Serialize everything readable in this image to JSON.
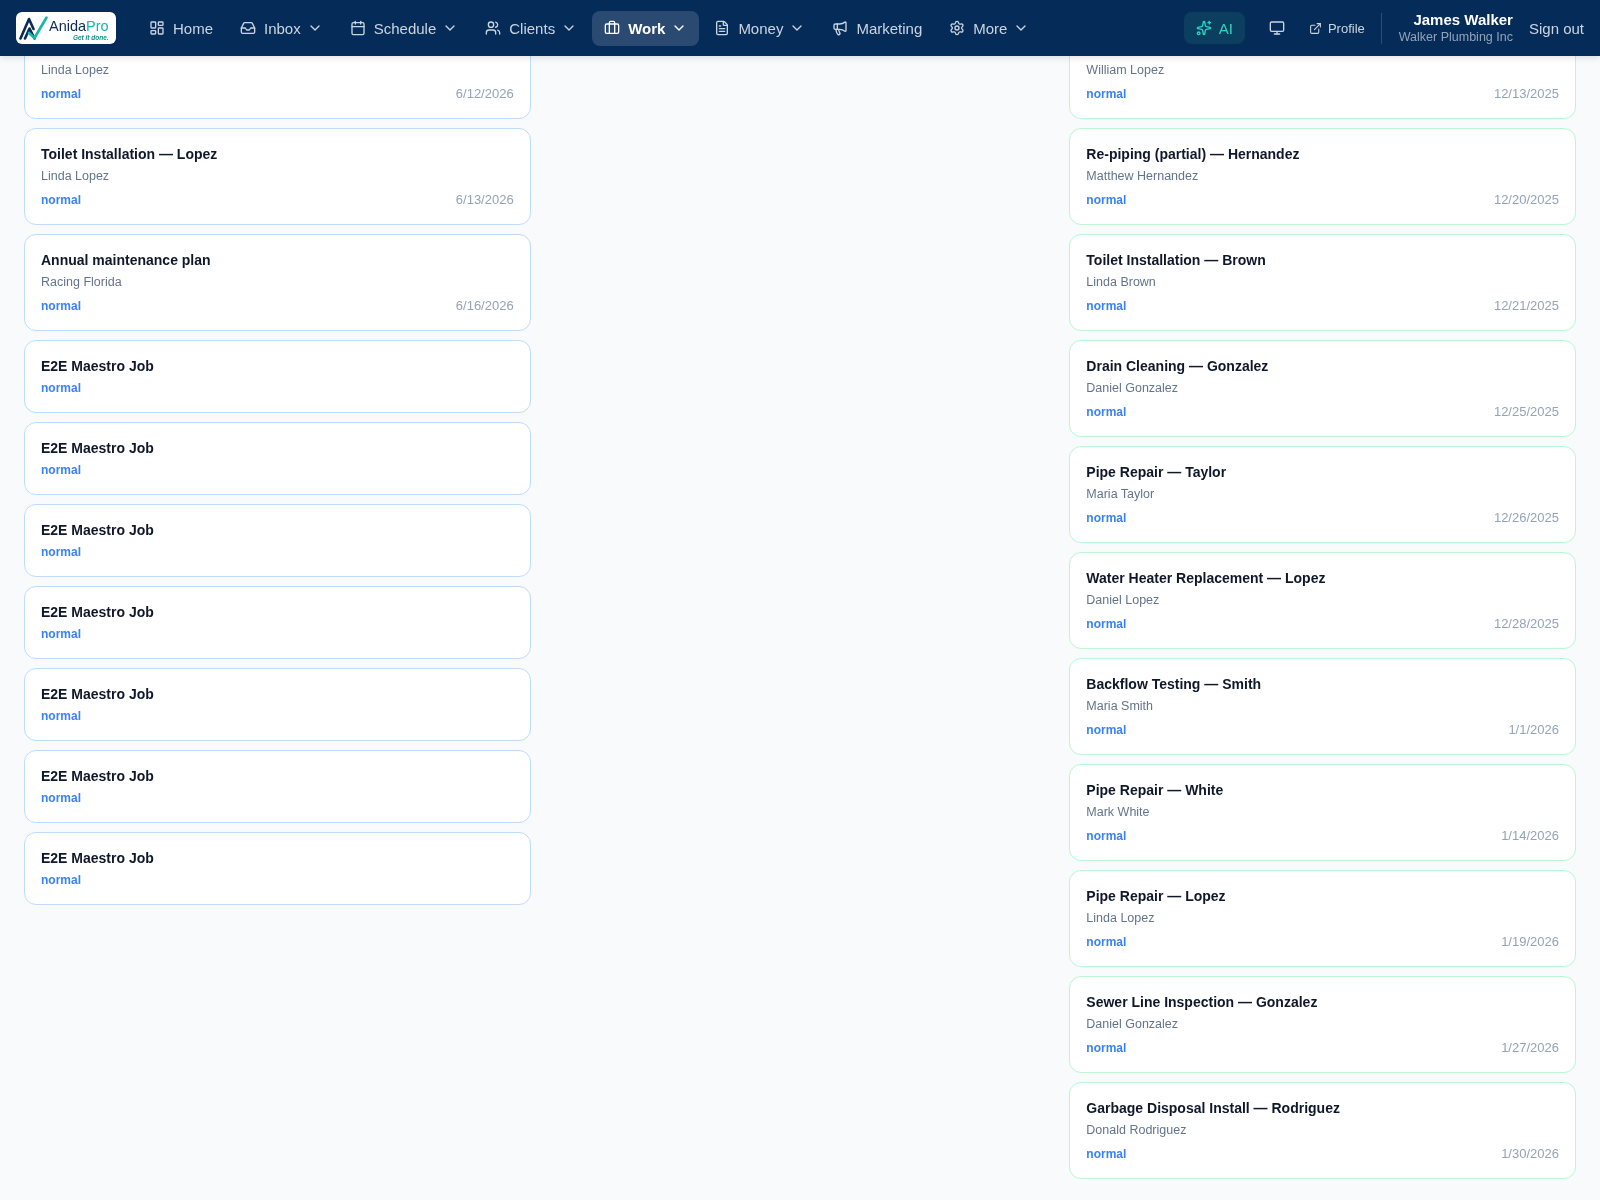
{
  "nav": {
    "logo": {
      "wordmark": "Anida",
      "wordmark_accent": "Pro",
      "tagline": "Get it done."
    },
    "items": [
      {
        "label": "Home",
        "selected": false,
        "dropdown": false
      },
      {
        "label": "Inbox",
        "selected": false,
        "dropdown": true
      },
      {
        "label": "Schedule",
        "selected": false,
        "dropdown": true
      },
      {
        "label": "Clients",
        "selected": false,
        "dropdown": true
      },
      {
        "label": "Work",
        "selected": true,
        "dropdown": true
      },
      {
        "label": "Money",
        "selected": false,
        "dropdown": true
      },
      {
        "label": "Marketing",
        "selected": false,
        "dropdown": false
      },
      {
        "label": "More",
        "selected": false,
        "dropdown": true
      }
    ],
    "ai_button": {
      "label": "AI"
    },
    "profile_link": {
      "label": "Profile"
    },
    "user": {
      "name": "James Walker",
      "company": "Walker Plumbing Inc"
    },
    "sign_out": {
      "label": "Sign out"
    }
  },
  "board": {
    "columns": [
      {
        "color": "#bfdbfe",
        "cards": [
          {
            "client": "Linda Lopez",
            "priority": "normal",
            "date": "6/12/2026"
          },
          {
            "title": "Toilet Installation — Lopez",
            "client": "Linda Lopez",
            "priority": "normal",
            "date": "6/13/2026"
          },
          {
            "title": "Annual maintenance plan",
            "client": "Racing Florida",
            "priority": "normal",
            "date": "6/16/2026"
          },
          {
            "title": "E2E Maestro Job",
            "priority": "normal"
          },
          {
            "title": "E2E Maestro Job",
            "priority": "normal"
          },
          {
            "title": "E2E Maestro Job",
            "priority": "normal"
          },
          {
            "title": "E2E Maestro Job",
            "priority": "normal"
          },
          {
            "title": "E2E Maestro Job",
            "priority": "normal"
          },
          {
            "title": "E2E Maestro Job",
            "priority": "normal"
          },
          {
            "title": "E2E Maestro Job",
            "priority": "normal"
          }
        ]
      },
      {},
      {
        "color": "#bbf7d0",
        "cards": [
          {
            "client": "William Lopez",
            "priority": "normal",
            "date": "12/13/2025"
          },
          {
            "title": "Re-piping (partial) — Hernandez",
            "client": "Matthew Hernandez",
            "priority": "normal",
            "date": "12/20/2025"
          },
          {
            "title": "Toilet Installation — Brown",
            "client": "Linda Brown",
            "priority": "normal",
            "date": "12/21/2025"
          },
          {
            "title": "Drain Cleaning — Gonzalez",
            "client": "Daniel Gonzalez",
            "priority": "normal",
            "date": "12/25/2025"
          },
          {
            "title": "Pipe Repair — Taylor",
            "client": "Maria Taylor",
            "priority": "normal",
            "date": "12/26/2025"
          },
          {
            "title": "Water Heater Replacement — Lopez",
            "client": "Daniel Lopez",
            "priority": "normal",
            "date": "12/28/2025"
          },
          {
            "title": "Backflow Testing — Smith",
            "client": "Maria Smith",
            "priority": "normal",
            "date": "1/1/2026"
          },
          {
            "title": "Pipe Repair — White",
            "client": "Mark White",
            "priority": "normal",
            "date": "1/14/2026"
          },
          {
            "title": "Pipe Repair — Lopez",
            "client": "Linda Lopez",
            "priority": "normal",
            "date": "1/19/2026"
          },
          {
            "title": "Sewer Line Inspection — Gonzalez",
            "client": "Daniel Gonzalez",
            "priority": "normal",
            "date": "1/27/2026"
          },
          {
            "title": "Garbage Disposal Install — Rodriguez",
            "client": "Donald Rodriguez",
            "priority": "normal",
            "date": "1/30/2026"
          }
        ]
      }
    ]
  }
}
